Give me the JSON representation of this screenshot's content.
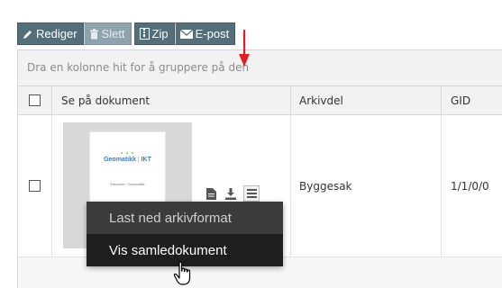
{
  "toolbar": {
    "buttons": [
      {
        "label": "Rediger",
        "icon": "pencil-icon",
        "disabled": false
      },
      {
        "label": "Slett",
        "icon": "trash-icon",
        "disabled": true
      },
      {
        "label": "Zip",
        "icon": "zip-file-icon",
        "disabled": false
      },
      {
        "label": "E-post",
        "icon": "envelope-icon",
        "disabled": false
      }
    ]
  },
  "grid": {
    "group_hint": "Dra en kolonne hit for å gruppere på den",
    "columns": [
      "Se på dokument",
      "Arkivdel",
      "GID"
    ],
    "rows": [
      {
        "thumbnail": {
          "logo_text": "Geomatikk",
          "logo_suffix": "IKT",
          "subtitle": "Eiendom / Geomatikk"
        },
        "arkivdel": "Byggesak",
        "gid": "1/1/0/0",
        "row_icons": [
          "document-icon",
          "download-icon",
          "menu-lines-icon"
        ]
      }
    ]
  },
  "context_menu": {
    "items": [
      {
        "label": "Last ned arkivformat",
        "hovered": false
      },
      {
        "label": "Vis samledokument",
        "hovered": true
      }
    ]
  },
  "colors": {
    "toolbar_button": "#546e7a",
    "toolbar_button_disabled": "#8ea3ad",
    "menu_background": "#3b3b3b",
    "menu_hover": "#1e1e1e",
    "annotation_arrow": "#e02020"
  }
}
